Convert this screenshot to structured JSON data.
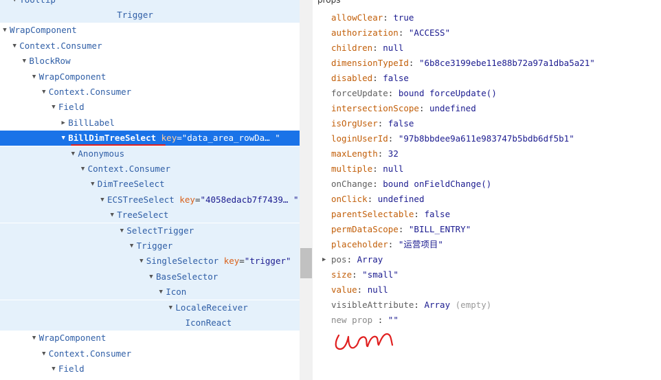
{
  "tree": {
    "rows": [
      {
        "indent": 1,
        "caret": "▼",
        "tag": "Tooltip",
        "shaded": true
      },
      {
        "indent": 11,
        "caret": "",
        "tag": "Trigger",
        "shaded": true
      },
      {
        "indent": 0,
        "caret": "▼",
        "tag": "WrapComponent"
      },
      {
        "indent": 1,
        "caret": "▼",
        "tag": "Context.Consumer"
      },
      {
        "indent": 2,
        "caret": "▼",
        "tag": "BlockRow"
      },
      {
        "indent": 3,
        "caret": "▼",
        "tag": "WrapComponent"
      },
      {
        "indent": 4,
        "caret": "▼",
        "tag": "Context.Consumer"
      },
      {
        "indent": 5,
        "caret": "▼",
        "tag": "Field"
      },
      {
        "indent": 6,
        "caret": "▶",
        "tag": "BillLabel"
      },
      {
        "indent": 6,
        "caret": "▼",
        "tag": "BillDimTreeSelect",
        "attr_name": "key",
        "attr_value": "\"data_area_rowDa… \"",
        "selected": true
      },
      {
        "indent": 7,
        "caret": "▼",
        "tag": "Anonymous",
        "shaded": true
      },
      {
        "indent": 8,
        "caret": "▼",
        "tag": "Context.Consumer",
        "shaded": true
      },
      {
        "indent": 9,
        "caret": "▼",
        "tag": "DimTreeSelect",
        "shaded": true
      },
      {
        "indent": 10,
        "caret": "▼",
        "tag": "ECSTreeSelect",
        "attr_name": "key",
        "attr_value": "\"4058edacb7f7439… \"",
        "shaded": true
      },
      {
        "indent": 11,
        "caret": "▼",
        "tag": "TreeSelect",
        "shaded": true
      },
      {
        "indent": 12,
        "caret": "▼",
        "tag": "SelectTrigger",
        "shaded": true
      },
      {
        "indent": 13,
        "caret": "▼",
        "tag": "Trigger",
        "shaded": true
      },
      {
        "indent": 14,
        "caret": "▼",
        "tag": "SingleSelector",
        "attr_name": "key",
        "attr_value": "\"trigger\"",
        "shaded": true
      },
      {
        "indent": 15,
        "caret": "▼",
        "tag": "BaseSelector",
        "shaded": true
      },
      {
        "indent": 16,
        "caret": "▼",
        "tag": "Icon",
        "shaded": true
      },
      {
        "indent": 17,
        "caret": "▼",
        "tag": "LocaleReceiver",
        "shaded": true
      },
      {
        "indent": 18,
        "caret": "",
        "tag": "IconReact",
        "shaded": true
      },
      {
        "indent": 3,
        "caret": "▼",
        "tag": "WrapComponent"
      },
      {
        "indent": 4,
        "caret": "▼",
        "tag": "Context.Consumer"
      },
      {
        "indent": 5,
        "caret": "▼",
        "tag": "Field"
      }
    ]
  },
  "props": {
    "heading": "props",
    "rows": [
      {
        "key": "allowClear",
        "value": "true",
        "style": "key"
      },
      {
        "key": "authorization",
        "value": "\"ACCESS\"",
        "style": "key"
      },
      {
        "key": "children",
        "value": "null",
        "style": "key"
      },
      {
        "key": "dimensionTypeId",
        "value": "\"6b8ce3199ebe11e88b72a97a1dba5a21\"",
        "style": "key"
      },
      {
        "key": "disabled",
        "value": "false",
        "style": "key"
      },
      {
        "key": "forceUpdate",
        "value": "bound forceUpdate()",
        "style": "plain"
      },
      {
        "key": "intersectionScope",
        "value": "undefined",
        "style": "key"
      },
      {
        "key": "isOrgUser",
        "value": "false",
        "style": "key"
      },
      {
        "key": "loginUserId",
        "value": "\"97b8bbdee9a611e983747b5bdb6df5b1\"",
        "style": "key"
      },
      {
        "key": "maxLength",
        "value": "32",
        "style": "key"
      },
      {
        "key": "multiple",
        "value": "null",
        "style": "key"
      },
      {
        "key": "onChange",
        "value": "bound onFieldChange()",
        "style": "plain"
      },
      {
        "key": "onClick",
        "value": "undefined",
        "style": "key"
      },
      {
        "key": "parentSelectable",
        "value": "false",
        "style": "key"
      },
      {
        "key": "permDataScope",
        "value": "\"BILL_ENTRY\"",
        "style": "key"
      },
      {
        "key": "placeholder",
        "value": "\"运营项目\"",
        "style": "key"
      },
      {
        "key": "pos",
        "value": "Array",
        "style": "plain",
        "expandable": true
      },
      {
        "key": "size",
        "value": "\"small\"",
        "style": "key"
      },
      {
        "key": "value",
        "value": "null",
        "style": "key"
      },
      {
        "key": "visibleAttribute",
        "value": "Array",
        "extra": "(empty)",
        "style": "plain"
      }
    ],
    "new_prop_placeholder": "new prop",
    "new_prop_value": "\"\""
  },
  "colors": {
    "selected_row": "#1a73e8",
    "shaded_row": "#e5f1fb",
    "annotation": "#e02020"
  }
}
